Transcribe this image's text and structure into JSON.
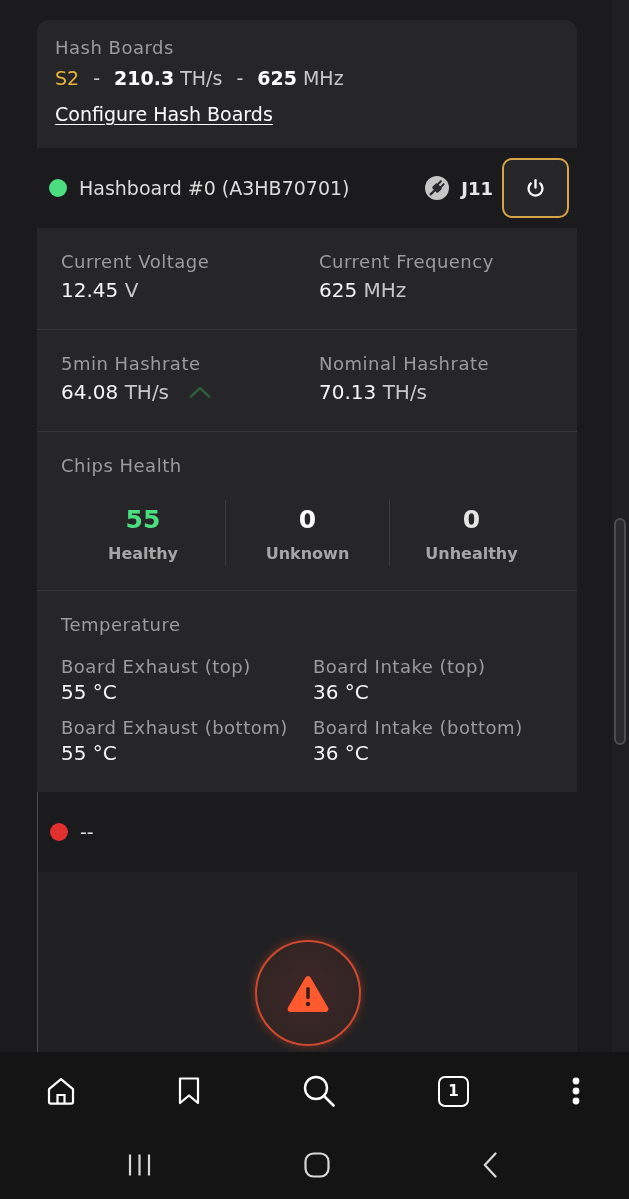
{
  "hash_boards": {
    "title": "Hash Boards",
    "summary": {
      "preset": "S2",
      "separators": [
        "-",
        "-"
      ],
      "hashrate": {
        "value": "210.3",
        "unit": "TH/s"
      },
      "frequency": {
        "value": "625",
        "unit": "MHz"
      }
    },
    "configure_link": "Configure Hash Boards"
  },
  "boards": [
    {
      "name": "Hashboard #0 (A3HB70701)",
      "color": "#4ade80",
      "connector": "J11",
      "power_button": {
        "focused": true
      },
      "details": {
        "metric_rows": [
          [
            {
              "label": "Current Voltage",
              "value": "12.45",
              "unit": "V",
              "rising": false
            },
            {
              "label": "Current Frequency",
              "value": "625",
              "unit": "MHz",
              "rising": false
            }
          ],
          [
            {
              "label": "5min Hashrate",
              "value": "64.08",
              "unit": "TH/s",
              "rising": true
            },
            {
              "label": "Nominal Hashrate",
              "value": "70.13",
              "unit": "TH/s",
              "rising": false
            }
          ]
        ],
        "chips_health": {
          "title": "Chips Health",
          "items": [
            {
              "count": "55",
              "label": "Healthy",
              "color": "#4ade80"
            },
            {
              "count": "0",
              "label": "Unknown",
              "color": "#ffffff"
            },
            {
              "count": "0",
              "label": "Unhealthy",
              "color": "#e4e4e4"
            }
          ]
        },
        "temperature": {
          "title": "Temperature",
          "sensors": [
            {
              "label": "Board Exhaust (top)",
              "value": "55 °C"
            },
            {
              "label": "Board Intake (top)",
              "value": "36 °C"
            },
            {
              "label": "Board Exhaust (bottom)",
              "value": "55 °C"
            },
            {
              "label": "Board Intake (bottom)",
              "value": "36 °C"
            }
          ]
        }
      }
    },
    {
      "name": "--",
      "color": "#e03030",
      "alert": {
        "kind": "warning"
      }
    }
  ],
  "browser_toolbar": [
    {
      "kind": "home"
    },
    {
      "kind": "bookmarks"
    },
    {
      "kind": "search"
    },
    {
      "kind": "tabs",
      "count": "1"
    },
    {
      "kind": "more"
    }
  ],
  "system_nav": [
    {
      "kind": "recents"
    },
    {
      "kind": "home"
    },
    {
      "kind": "back"
    }
  ]
}
